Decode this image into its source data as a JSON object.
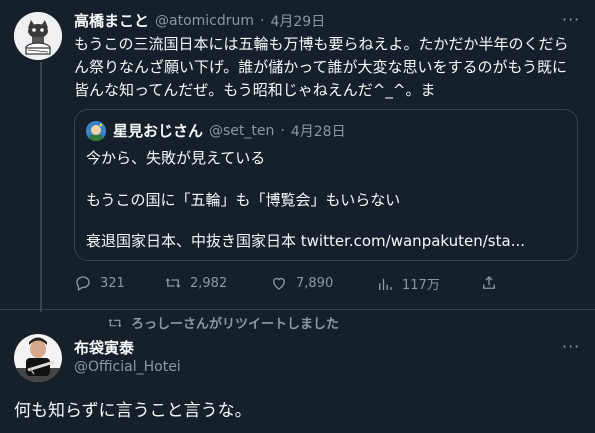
{
  "tweet": {
    "author_name": "高橋まこと",
    "author_handle": "@atomicdrum",
    "separator": "·",
    "date": "4月29日",
    "more_glyph": "···",
    "text": "もうこの三流国日本には五輪も万博も要らねえよ。たかだか半年のくだらん祭りなんざ願い下げ。誰が儲かって誰が大変な思いをするのがもう既に皆んな知ってんだぜ。もう昭和じゃねえんだ^_^。ま",
    "quote": {
      "author_name": "星見おじさん",
      "author_handle": "@set_ten",
      "separator": "·",
      "date": "4月28日",
      "lines": [
        "今から、失敗が見えている",
        "もうこの国に「五輪」も「博覧会」もいらない",
        "衰退国家日本、中抜き国家日本 twitter.com/wanpakuten/sta..."
      ]
    },
    "actions": {
      "reply_count": "321",
      "retweet_count": "2,982",
      "like_count": "7,890",
      "views_count": "117万"
    }
  },
  "retweet_banner": "ろっしーさんがリツイートしました",
  "tweet2": {
    "author_name": "布袋寅泰",
    "author_handle": "@Official_Hotei",
    "more_glyph": "···",
    "text": "何も知らずに言うこと言うな。"
  },
  "icons": [
    "reply-icon",
    "retweet-icon",
    "like-icon",
    "views-icon",
    "share-icon"
  ]
}
